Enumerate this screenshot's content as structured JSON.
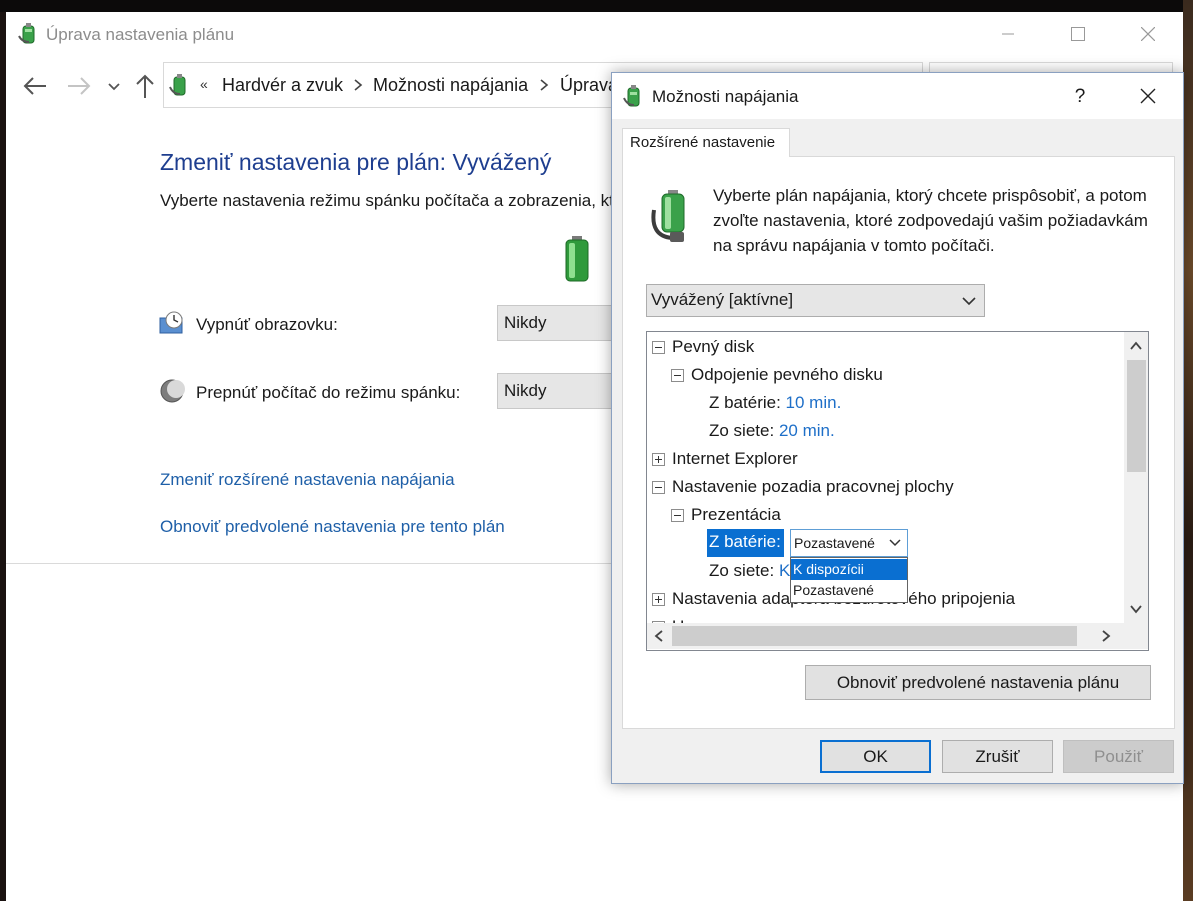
{
  "main_window": {
    "title": "Úprava nastavenia plánu",
    "breadcrumb": {
      "chevrons": "«",
      "items": [
        "Hardvér a zvuk",
        "Možnosti napájania",
        "Úprava nastavenia plánu"
      ]
    },
    "heading": "Zmeniť nastavenia pre plán: Vyvážený",
    "description": "Vyberte nastavenia režimu spánku počítača a zobrazenia, ktoré má počítač používať.",
    "settings": [
      {
        "label": "Vypnúť obrazovku:",
        "value": "Nikdy",
        "icon": "monitor-clock-icon"
      },
      {
        "label": "Prepnúť počítač do režimu spánku:",
        "value": "Nikdy",
        "icon": "moon-icon"
      }
    ],
    "links": {
      "advanced": "Zmeniť rozšírené nastavenia napájania",
      "restore": "Obnoviť predvolené nastavenia pre tento plán"
    }
  },
  "dialog": {
    "title": "Možnosti napájania",
    "help_label": "?",
    "tab": "Rozšírené nastavenie",
    "description": "Vyberte plán napájania, ktorý chcete prispôsobiť, a potom zvoľte nastavenia, ktoré zodpovedajú vašim požiadavkám na správu napájania v tomto počítači.",
    "plan_select": "Vyvážený [aktívne]",
    "tree": {
      "hard_disk": "Pevný disk",
      "hard_disk_off": "Odpojenie pevného disku",
      "on_battery_label": "Z batérie:",
      "on_battery_value": "10 min.",
      "plugged_in_label": "Zo siete:",
      "plugged_in_value": "20 min.",
      "internet_explorer": "Internet Explorer",
      "desktop_background": "Nastavenie pozadia pracovnej plochy",
      "slideshow": "Prezentácia",
      "slideshow_battery_label": "Z batérie:",
      "slideshow_battery_value": "Pozastavené",
      "slideshow_plugged_label": "Zo siete:",
      "slideshow_plugged_value": "K",
      "wireless_adapter": "Nastavenia adaptéra bezdrôtového pripojenia",
      "next_partial": "Usp..."
    },
    "dropdown_options": [
      "K dispozícii",
      "Pozastavené"
    ],
    "restore_button": "Obnoviť predvolené nastavenia plánu",
    "buttons": {
      "ok": "OK",
      "cancel": "Zrušiť",
      "apply": "Použiť"
    }
  },
  "colors": {
    "accent": "#0a6fd1",
    "link": "#1e5fa8",
    "heading": "#1e3e8f",
    "tree_value": "#1e6fc8"
  }
}
